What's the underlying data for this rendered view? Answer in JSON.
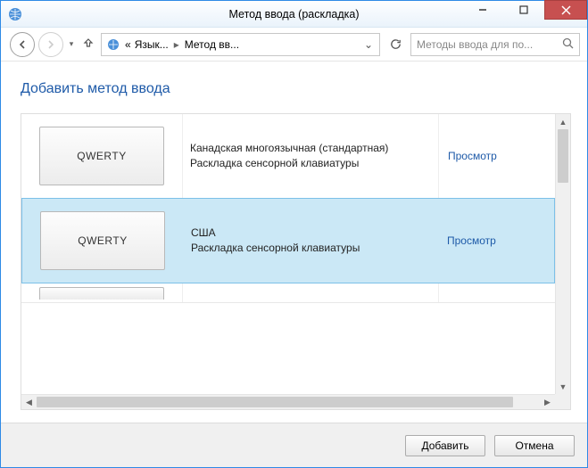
{
  "window": {
    "title": "Метод ввода (раскладка)"
  },
  "breadcrumb": {
    "prefix": "«",
    "item1": "Язык...",
    "item2": "Метод вв..."
  },
  "search": {
    "placeholder": "Методы ввода для по..."
  },
  "page": {
    "title": "Добавить метод ввода"
  },
  "rows": [
    {
      "thumb": "QWERTY",
      "name": "Канадская многоязычная (стандартная)",
      "sub": "Раскладка сенсорной клавиатуры",
      "preview": "Просмотр",
      "selected": false
    },
    {
      "thumb": "QWERTY",
      "name": "США",
      "sub": "Раскладка сенсорной клавиатуры",
      "preview": "Просмотр",
      "selected": true
    }
  ],
  "buttons": {
    "add": "Добавить",
    "cancel": "Отмена"
  }
}
